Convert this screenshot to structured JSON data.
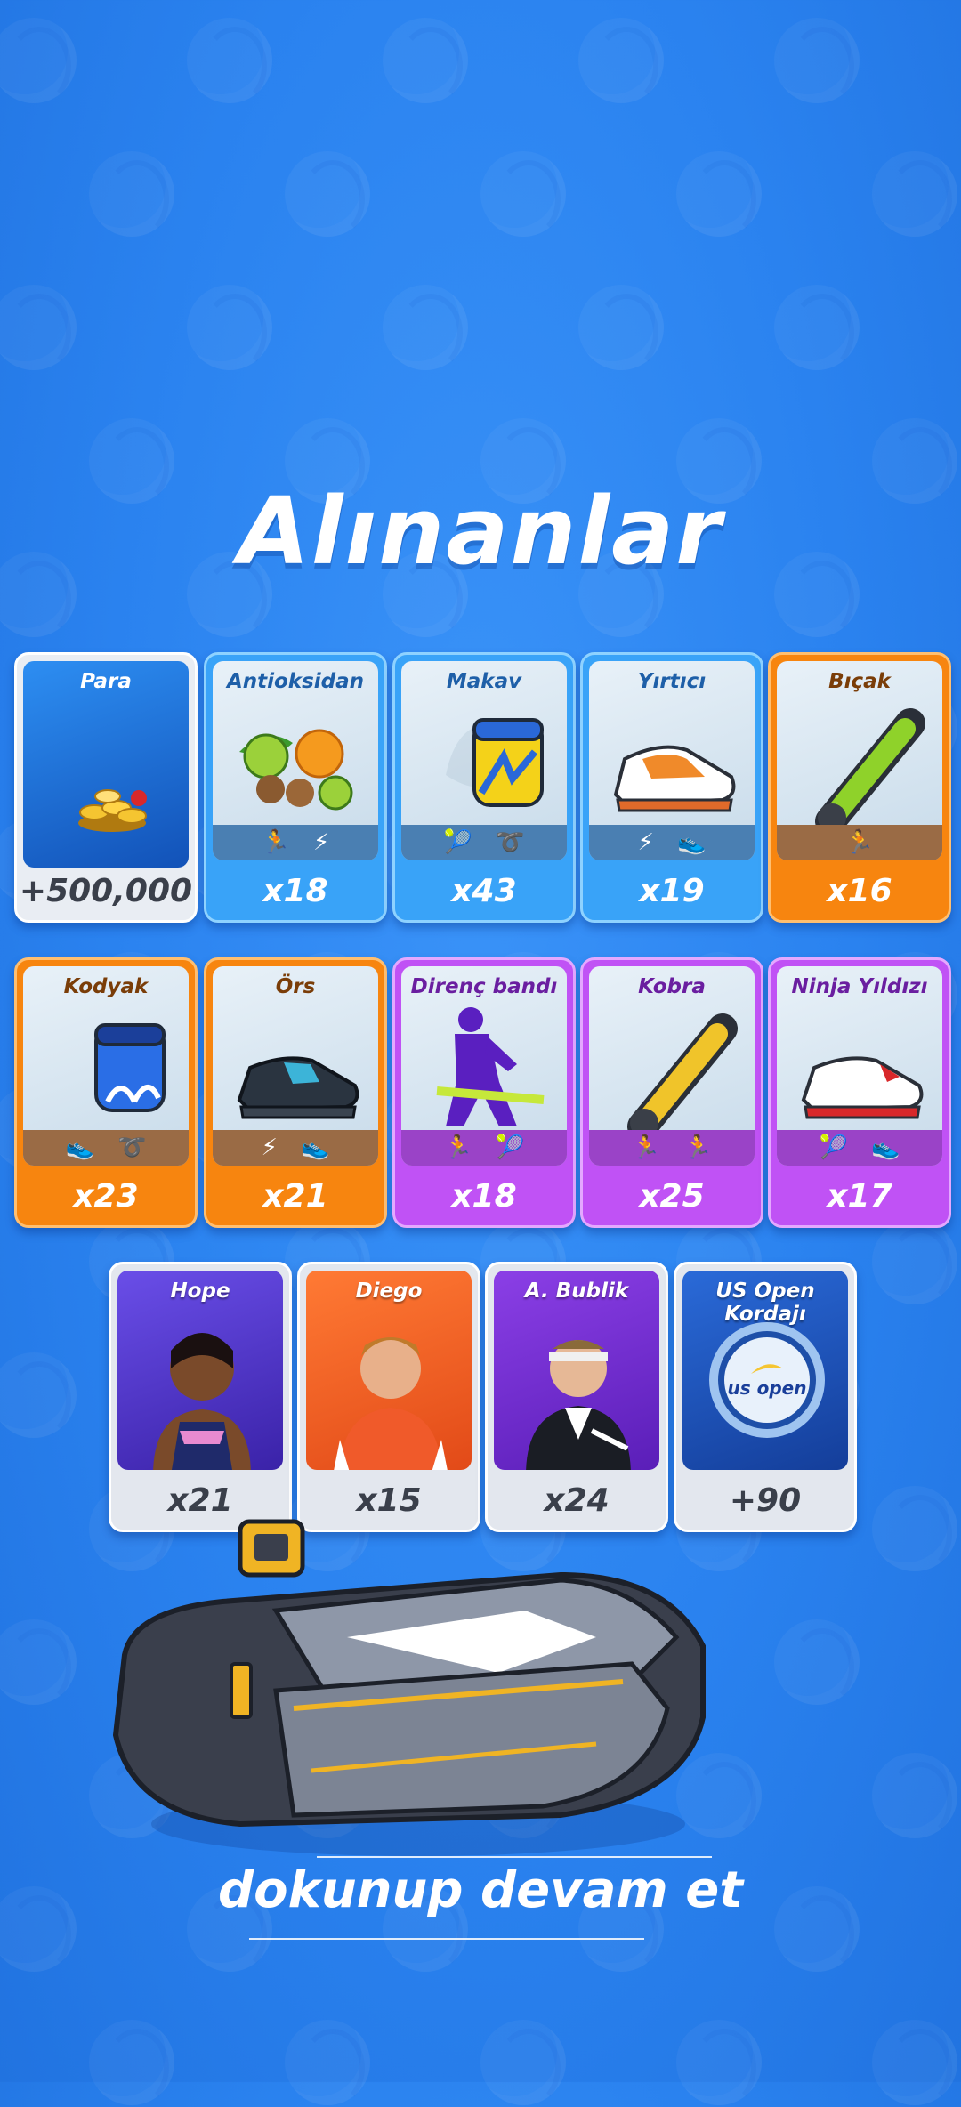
{
  "title": "Alınanlar",
  "row1": [
    {
      "name": "Para",
      "count": "+500,000",
      "rarity": "coin",
      "icon": "coins-icon",
      "stats": []
    },
    {
      "name": "Antioksidan",
      "count": "x18",
      "rarity": "blue",
      "icon": "fruit-icon",
      "stats": [
        "stamina-icon",
        "power-icon"
      ]
    },
    {
      "name": "Makav",
      "count": "x43",
      "rarity": "blue",
      "icon": "wristband-icon",
      "stats": [
        "control-icon",
        "agility-icon"
      ]
    },
    {
      "name": "Yırtıcı",
      "count": "x19",
      "rarity": "blue",
      "icon": "shoe-icon",
      "stats": [
        "power-icon",
        "speed-icon"
      ]
    },
    {
      "name": "Bıçak",
      "count": "x16",
      "rarity": "orange",
      "icon": "grip-icon",
      "stats": [
        "stamina-icon"
      ]
    }
  ],
  "row2": [
    {
      "name": "Kodyak",
      "count": "x23",
      "rarity": "orange",
      "icon": "wristband-icon",
      "stats": [
        "speed-icon",
        "agility-icon"
      ]
    },
    {
      "name": "Örs",
      "count": "x21",
      "rarity": "orange",
      "icon": "shoe-icon",
      "stats": [
        "power-icon",
        "speed-icon"
      ]
    },
    {
      "name": "Direnç bandı",
      "count": "x18",
      "rarity": "purple",
      "icon": "training-icon",
      "stats": [
        "stamina-icon",
        "control-icon"
      ]
    },
    {
      "name": "Kobra",
      "count": "x25",
      "rarity": "purple",
      "icon": "grip-icon",
      "stats": [
        "stamina-icon",
        "stamina-icon"
      ]
    },
    {
      "name": "Ninja Yıldızı",
      "count": "x17",
      "rarity": "purple",
      "icon": "shoe-icon",
      "stats": [
        "control-icon",
        "speed-icon"
      ]
    }
  ],
  "row3": [
    {
      "name": "Hope",
      "count": "x21",
      "icon": "player-portrait-hope",
      "bg": "#5b3fd6"
    },
    {
      "name": "Diego",
      "count": "x15",
      "icon": "player-portrait-diego",
      "bg": "#f26a2a"
    },
    {
      "name": "A. Bublik",
      "count": "x24",
      "icon": "player-portrait-bublik",
      "bg": "#7b2fd8"
    },
    {
      "name": "US Open Kordajı",
      "count": "+90",
      "icon": "us-open-strings-icon",
      "bg": "#1a56b8",
      "logo_text": "us open"
    }
  ],
  "tap_text": "dokunup devam et",
  "colors": {
    "background": "#2a82ef",
    "blue": "#39a3f8",
    "orange": "#f7850f",
    "purple": "#c052f5"
  }
}
